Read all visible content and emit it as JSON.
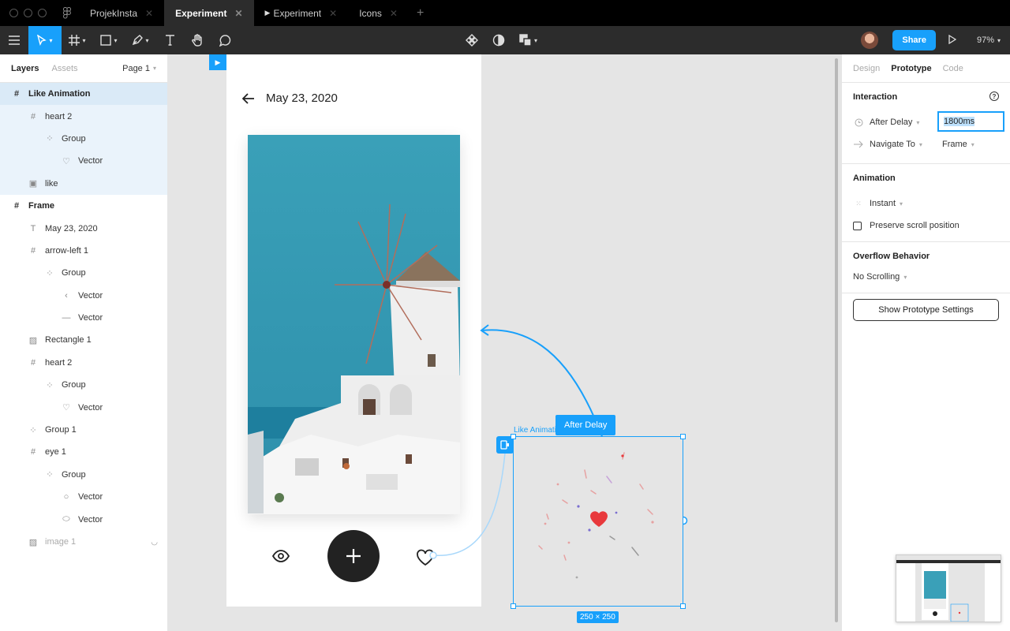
{
  "window": {
    "tabs": [
      {
        "label": "ProjekInsta",
        "active": false
      },
      {
        "label": "Experiment",
        "active": true
      },
      {
        "label": "Experiment",
        "active": false,
        "prototype": true
      },
      {
        "label": "Icons",
        "active": false
      }
    ]
  },
  "toolbar": {
    "share_label": "Share",
    "zoom": "97%"
  },
  "layers_panel": {
    "tab_layers": "Layers",
    "tab_assets": "Assets",
    "page": "Page 1",
    "items": [
      {
        "label": "Like Animation",
        "icon": "frame-icon",
        "depth": 0
      },
      {
        "label": "heart 2",
        "icon": "frame-icon",
        "depth": 1
      },
      {
        "label": "Group",
        "icon": "group-icon",
        "depth": 2
      },
      {
        "label": "Vector",
        "icon": "heart-vector-icon",
        "depth": 3
      },
      {
        "label": "like",
        "icon": "component-icon",
        "depth": 1
      },
      {
        "label": "Frame",
        "icon": "frame-icon",
        "depth": 0
      },
      {
        "label": "May 23, 2020",
        "icon": "text-icon",
        "depth": 1
      },
      {
        "label": "arrow-left 1",
        "icon": "frame-icon",
        "depth": 1
      },
      {
        "label": "Group",
        "icon": "group-icon",
        "depth": 2
      },
      {
        "label": "Vector",
        "icon": "chevron-vector-icon",
        "depth": 3
      },
      {
        "label": "Vector",
        "icon": "line-vector-icon",
        "depth": 3
      },
      {
        "label": "Rectangle 1",
        "icon": "image-icon",
        "depth": 1
      },
      {
        "label": "heart 2",
        "icon": "frame-icon",
        "depth": 1
      },
      {
        "label": "Group",
        "icon": "group-icon",
        "depth": 2
      },
      {
        "label": "Vector",
        "icon": "heart-vector-icon",
        "depth": 3
      },
      {
        "label": "Group 1",
        "icon": "group-icon",
        "depth": 1
      },
      {
        "label": "eye 1",
        "icon": "frame-icon",
        "depth": 1
      },
      {
        "label": "Group",
        "icon": "group-icon",
        "depth": 2
      },
      {
        "label": "Vector",
        "icon": "circle-vector-icon",
        "depth": 3
      },
      {
        "label": "Vector",
        "icon": "ellipse-vector-icon",
        "depth": 3
      },
      {
        "label": "image 1",
        "icon": "image-icon",
        "depth": 1
      }
    ]
  },
  "canvas": {
    "frame_date": "May 23, 2020",
    "like_frame_label": "Like Animation",
    "interaction_tag": "After Delay",
    "size_tag": "250 × 250"
  },
  "right_panel": {
    "tabs": [
      "Design",
      "Prototype",
      "Code"
    ],
    "active_tab": "Prototype",
    "interaction": {
      "title": "Interaction",
      "trigger": "After Delay",
      "delay_value": "1800ms",
      "action": "Navigate To",
      "destination": "Frame"
    },
    "animation": {
      "title": "Animation",
      "type": "Instant",
      "preserve_scroll_label": "Preserve scroll position"
    },
    "overflow": {
      "title": "Overflow Behavior",
      "value": "No Scrolling"
    },
    "settings_button": "Show Prototype Settings"
  },
  "colors": {
    "accent": "#18a0fb",
    "heart": "#e8393c"
  }
}
